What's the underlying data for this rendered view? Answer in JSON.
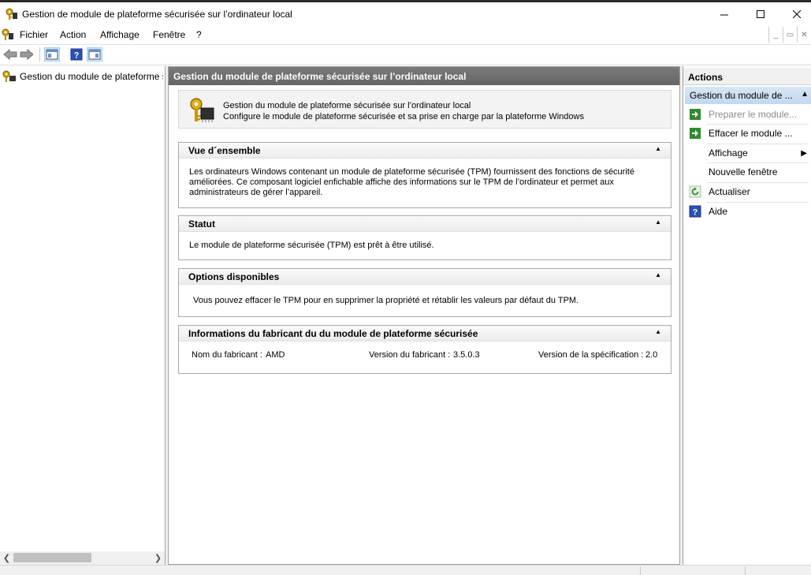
{
  "window": {
    "title": "Gestion de module de plateforme sécurisée sur l’ordinateur local",
    "app_icon": "tpm-key-icon",
    "minimize_glyph": "—",
    "maximize_glyph": "☐",
    "close_glyph": "✕"
  },
  "menu": {
    "items": [
      "Fichier",
      "Action",
      "Affichage",
      "Fenêtre",
      "?"
    ]
  },
  "toolbar": {
    "buttons": [
      "back-arrow-icon",
      "forward-arrow-icon",
      "console-tree-icon",
      "help-icon",
      "show-actions-icon"
    ]
  },
  "tree": {
    "root_label": "Gestion du module de plateforme sécurisée sur l’ordinateur local"
  },
  "center": {
    "header": "Gestion du module de plateforme sécurisée sur l’ordinateur local",
    "intro_line1": "Gestion du module de plateforme sécurisée sur l’ordinateur local",
    "intro_line2": "Configure le module de plateforme sécurisée et sa prise en charge par la plateforme Windows",
    "sections": {
      "overview": {
        "title": "Vue d´ensemble",
        "body": "Les ordinateurs Windows contenant un module de plateforme sécurisée (TPM) fournissent des fonctions de sécurité améliorées. Ce composant logiciel enfichable affiche des informations sur le TPM de l’ordinateur et permet aux administrateurs de gérer l’appareil."
      },
      "status": {
        "title": "Statut",
        "body": "Le module de plateforme sécurisée (TPM) est prêt à être utilisé."
      },
      "options": {
        "title": "Options disponibles",
        "body": "Vous pouvez effacer le TPM pour en supprimer la propriété et rétablir les valeurs par défaut du TPM."
      },
      "manufacturer": {
        "title": "Informations du fabricant du du module de plateforme sécurisée",
        "name_label": "Nom du fabricant :",
        "name_value": "AMD",
        "version_label": "Version du fabricant :",
        "version_value": "3.5.0.3",
        "spec_label": "Version de la spécification :",
        "spec_value": "2.0"
      }
    }
  },
  "actions": {
    "title": "Actions",
    "group_label": "Gestion du module de ...",
    "items": [
      {
        "label": "Preparer le module...",
        "icon": "green-arrow-icon",
        "enabled": false
      },
      {
        "label": "Effacer le module ...",
        "icon": "green-arrow-icon",
        "enabled": true
      },
      {
        "label": "Affichage",
        "icon": "",
        "enabled": true,
        "submenu": true
      },
      {
        "label": "Nouvelle fenêtre",
        "icon": "",
        "enabled": true
      },
      {
        "label": "Actualiser",
        "icon": "refresh-icon",
        "enabled": true
      },
      {
        "label": "Aide",
        "icon": "help-icon",
        "enabled": true
      }
    ]
  },
  "colors": {
    "header_bg": "#6e6e6e",
    "actions_group_bg": "#cfe0f3",
    "accent_green": "#2e8b2e",
    "help_blue": "#2a4fb5"
  }
}
